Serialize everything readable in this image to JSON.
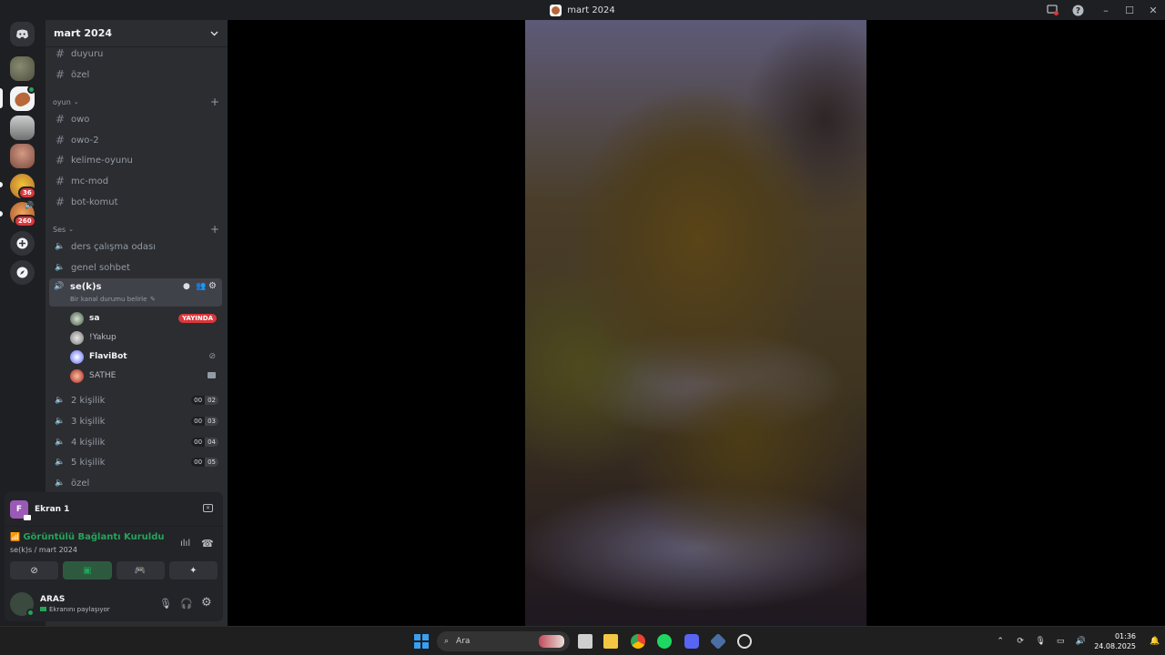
{
  "window": {
    "title": "mart 2024"
  },
  "server": {
    "name": "mart 2024"
  },
  "guild_badges": {
    "g5": "36",
    "g6": "260"
  },
  "channels_top": [
    {
      "label": "duyuru"
    },
    {
      "label": "özel"
    }
  ],
  "categories": {
    "oyun": "oyun",
    "ses": "Ses"
  },
  "text_channels": [
    {
      "label": "owo"
    },
    {
      "label": "owo-2"
    },
    {
      "label": "kelime-oyunu"
    },
    {
      "label": "mc-mod"
    },
    {
      "label": "bot-komut"
    }
  ],
  "voice_channels": [
    {
      "label": "ders çalışma odası"
    },
    {
      "label": "genel sohbet"
    }
  ],
  "active_voice": {
    "name": "se(k)s",
    "status": "Bir kanal durumu belirle"
  },
  "voice_users": [
    {
      "name": "sa",
      "badge": "YAYINDA"
    },
    {
      "name": "!Yakup"
    },
    {
      "name": "FlaviBot"
    },
    {
      "name": "SATHE"
    }
  ],
  "rooms": [
    {
      "label": "2 kişilik",
      "a": "00",
      "b": "02"
    },
    {
      "label": "3 kişilik",
      "a": "00",
      "b": "03"
    },
    {
      "label": "4 kişilik",
      "a": "00",
      "b": "04"
    },
    {
      "label": "5 kişilik",
      "a": "00",
      "b": "05"
    }
  ],
  "last_channel": {
    "label": "özel"
  },
  "screen_panel": {
    "title": "Ekran 1",
    "initial": "F"
  },
  "connection": {
    "status": "Görüntülü Bağlantı Kuruldu",
    "location": "se(k)s / mart 2024"
  },
  "user": {
    "name": "ARAS",
    "status": "Ekranını paylaşıyor"
  },
  "taskbar": {
    "search_placeholder": "Ara",
    "time": "01:36",
    "date": "24.08.2025"
  },
  "colors": {
    "accent": "#5865f2",
    "green": "#23a55a",
    "red": "#da373c"
  }
}
